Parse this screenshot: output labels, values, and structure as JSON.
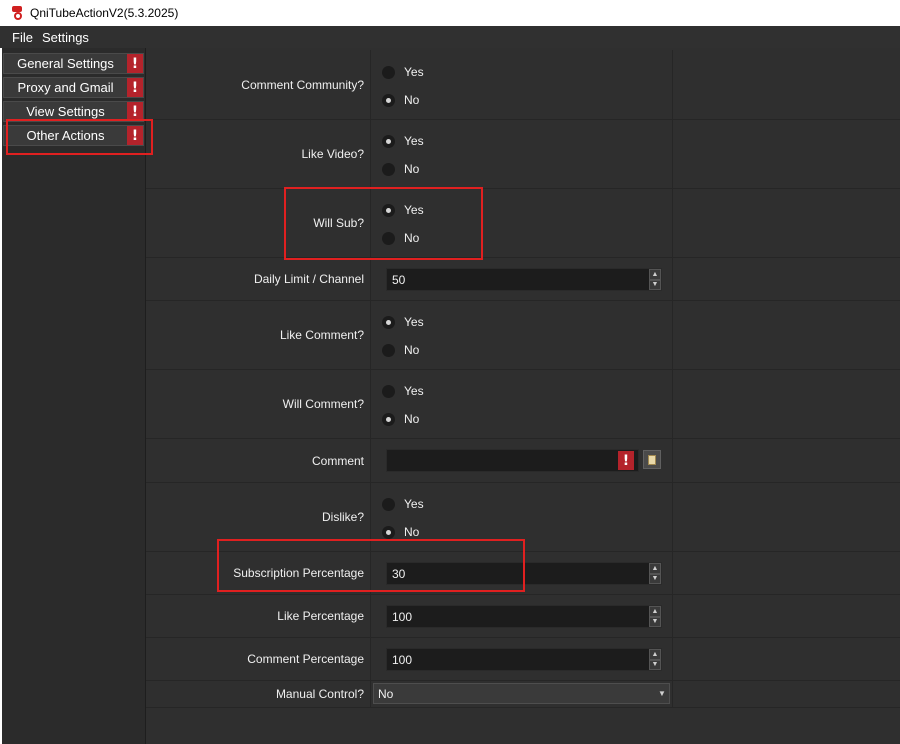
{
  "window": {
    "title": "QniTubeActionV2(5.3.2025)"
  },
  "menubar": {
    "items": [
      "File",
      "Settings"
    ]
  },
  "sidebar": {
    "items": [
      {
        "label": "General Settings",
        "alert": "!"
      },
      {
        "label": "Proxy and Gmail",
        "alert": "!"
      },
      {
        "label": "View Settings",
        "alert": "!"
      },
      {
        "label": "Other Actions",
        "alert": "!"
      }
    ]
  },
  "form": {
    "comment_community": {
      "label": "Comment Community?",
      "yes": "Yes",
      "no": "No",
      "selected": "No"
    },
    "like_video": {
      "label": "Like Video?",
      "yes": "Yes",
      "no": "No",
      "selected": "Yes"
    },
    "will_sub": {
      "label": "Will Sub?",
      "yes": "Yes",
      "no": "No",
      "selected": "Yes"
    },
    "daily_limit": {
      "label": "Daily Limit / Channel",
      "value": "50"
    },
    "like_comment": {
      "label": "Like Comment?",
      "yes": "Yes",
      "no": "No",
      "selected": "Yes"
    },
    "will_comment": {
      "label": "Will Comment?",
      "yes": "Yes",
      "no": "No",
      "selected": "No"
    },
    "comment": {
      "label": "Comment",
      "value": "",
      "alert": "!"
    },
    "dislike": {
      "label": "Dislike?",
      "yes": "Yes",
      "no": "No",
      "selected": "No"
    },
    "subscription_percentage": {
      "label": "Subscription Percentage",
      "value": "30"
    },
    "like_percentage": {
      "label": "Like Percentage",
      "value": "100"
    },
    "comment_percentage": {
      "label": "Comment Percentage",
      "value": "100"
    },
    "manual_control": {
      "label": "Manual Control?",
      "value": "No"
    }
  },
  "icons": {
    "alert": "exclamation-icon",
    "spin_up": "▲",
    "spin_down": "▼",
    "combo_arrow": "▼"
  },
  "colors": {
    "alert": "#b4232b",
    "highlight": "#e02020",
    "panel": "#2f2f2f"
  }
}
